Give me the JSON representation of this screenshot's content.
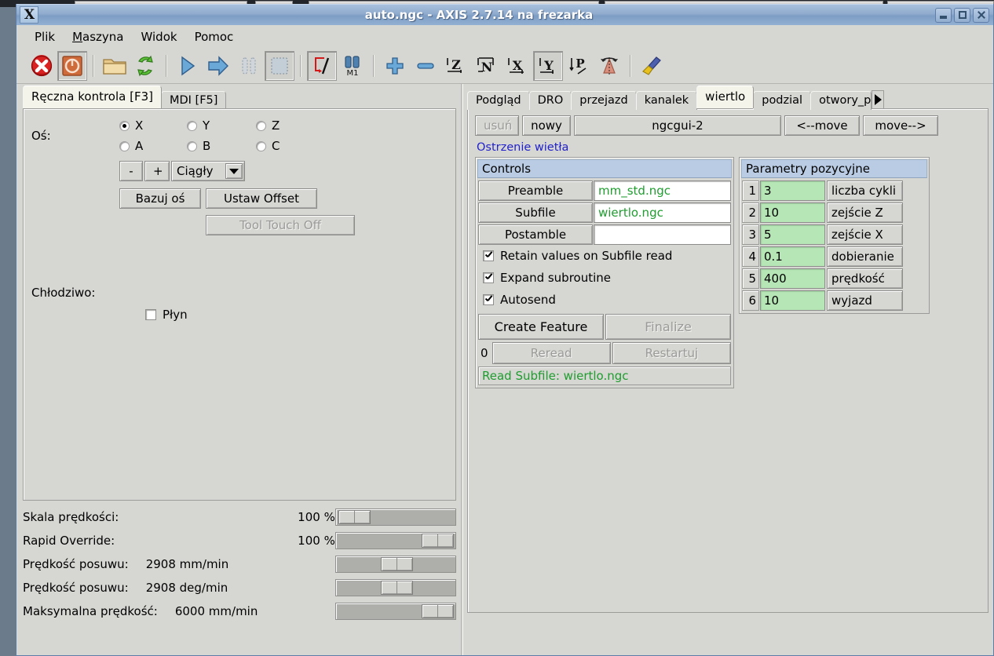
{
  "window": {
    "title": "auto.ngc - AXIS 2.7.14 na frezarka",
    "icon": "X",
    "minimize_label": "",
    "maximize_label": "",
    "close_label": ""
  },
  "menubar": [
    {
      "label": "Plik",
      "mnemonic": ""
    },
    {
      "label": "Maszyna",
      "mnemonic": "M"
    },
    {
      "label": "Widok",
      "mnemonic": ""
    },
    {
      "label": "Pomoc",
      "mnemonic": ""
    }
  ],
  "toolbar": [
    {
      "name": "estop-icon",
      "label": "Estop"
    },
    {
      "name": "power-icon",
      "label": "Power",
      "pressed": true
    },
    {
      "name": "open-folder-icon",
      "label": "Otworz"
    },
    {
      "name": "reload-icon",
      "label": "Przeladuj"
    },
    {
      "name": "run-icon",
      "label": "Start"
    },
    {
      "name": "step-icon",
      "label": "Krok"
    },
    {
      "name": "pause-icon",
      "label": "Pauza"
    },
    {
      "name": "stop-icon",
      "label": "Stop"
    },
    {
      "name": "skip-lines-icon",
      "label": "Pomijanie blokow"
    },
    {
      "name": "optional-stop-icon",
      "label": "M1 opcjonalny stop"
    },
    {
      "name": "zoom-in-icon",
      "label": "Przybliz"
    },
    {
      "name": "zoom-out-icon",
      "label": "Oddal"
    },
    {
      "name": "view-z-icon",
      "label": "Widok Z"
    },
    {
      "name": "view-z2-icon",
      "label": "Widok Z2"
    },
    {
      "name": "view-x-icon",
      "label": "Widok X"
    },
    {
      "name": "view-y-icon",
      "label": "Widok Y",
      "pressed": true
    },
    {
      "name": "view-p-icon",
      "label": "Widok P"
    },
    {
      "name": "view-rotate-icon",
      "label": "Obrot"
    },
    {
      "name": "clear-plot-icon",
      "label": "Wyczysc"
    }
  ],
  "left_panel": {
    "tabs": [
      {
        "label": "Ręczna kontrola [F3]",
        "active": true
      },
      {
        "label": "MDI [F5]",
        "active": false
      }
    ],
    "axis_label": "Oś:",
    "axes": [
      {
        "label": "X",
        "selected": true
      },
      {
        "label": "Y",
        "selected": false
      },
      {
        "label": "Z",
        "selected": false
      },
      {
        "label": "A",
        "selected": false
      },
      {
        "label": "B",
        "selected": false
      },
      {
        "label": "C",
        "selected": false
      }
    ],
    "jog_minus": "-",
    "jog_plus": "+",
    "jog_mode": "Ciągły",
    "home_button": "Bazuj oś",
    "offset_button": "Ustaw Offset",
    "tool_touch_off_button": "Tool Touch Off",
    "coolant_label": "Chłodziwo:",
    "coolant_flood": "Płyn"
  },
  "sliders": [
    {
      "label": "Skala prędkości:",
      "value": "100 %",
      "pos": 3
    },
    {
      "label": "Rapid Override:",
      "value": "100 %",
      "pos": 73
    },
    {
      "label": "Prędkość posuwu:",
      "value": "2908 mm/min",
      "pos": 42
    },
    {
      "label": "Prędkość posuwu:",
      "value": "2908 deg/min",
      "pos": 42
    },
    {
      "label": "Maksymalna prędkość:",
      "value": "6000 mm/min",
      "pos": 73
    }
  ],
  "right_panel": {
    "tabs": [
      {
        "label": "Podgląd",
        "active": false
      },
      {
        "label": "DRO",
        "active": false
      },
      {
        "label": "przejazd",
        "active": false
      },
      {
        "label": "kanalek",
        "active": false
      },
      {
        "label": "wiertlo",
        "active": true
      },
      {
        "label": "podzial",
        "active": false
      },
      {
        "label": "otwory_po",
        "active": false
      }
    ],
    "tab_scroll_right": "▶",
    "toolbar": {
      "delete_button": "usuń",
      "new_button": "nowy",
      "page_name": "ngcgui-2",
      "move_left_button": "<--move",
      "move_right_button": "move-->"
    },
    "feature_title": "Ostrzenie wietła",
    "controls": {
      "header": "Controls",
      "rows": [
        {
          "button": "Preamble",
          "value": "mm_std.ngc"
        },
        {
          "button": "Subfile",
          "value": "wiertlo.ngc"
        },
        {
          "button": "Postamble",
          "value": ""
        }
      ],
      "checkboxes": [
        {
          "label": "Retain values on Subfile read",
          "checked": true
        },
        {
          "label": "Expand subroutine",
          "checked": true
        },
        {
          "label": "Autosend",
          "checked": true
        }
      ],
      "create_feature_button": "Create Feature",
      "finalize_button": "Finalize",
      "count": "0",
      "reread_button": "Reread",
      "restart_button": "Restartuj",
      "status": "Read Subfile: wiertlo.ngc"
    },
    "params": {
      "header": "Parametry pozycyjne",
      "rows": [
        {
          "index": "1",
          "value": "3",
          "name": "liczba cykli"
        },
        {
          "index": "2",
          "value": "10",
          "name": "zejście Z"
        },
        {
          "index": "3",
          "value": "5",
          "name": "zejście X"
        },
        {
          "index": "4",
          "value": "0.1",
          "name": "dobieranie"
        },
        {
          "index": "5",
          "value": "400",
          "name": "prędkość"
        },
        {
          "index": "6",
          "value": "10",
          "name": "wyjazd"
        }
      ]
    }
  },
  "colors": {
    "titlebar": "#8fabcd",
    "panel_bg": "#d6d6d3",
    "header_blue": "#b9cce4",
    "value_green_bg": "#b6e6b6",
    "entry_green_text": "#1f9d2f",
    "feature_title_blue": "#2222cc",
    "active_tab": "#f4f4ea"
  }
}
